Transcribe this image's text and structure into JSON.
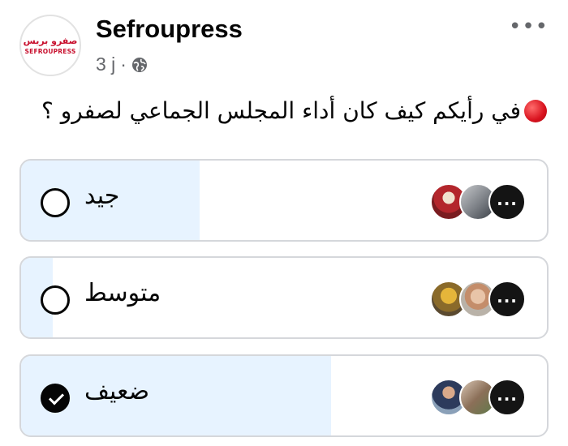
{
  "post": {
    "logo_text_arabic": "صفرو بريس",
    "logo_text_latin": "SEFROUPRESS",
    "page_name": "Sefroupress",
    "time": "3 j",
    "separator": "·",
    "question": "في رأيكم كيف كان أداء المجلس الجماعي لصفرو ؟",
    "more_icon": "more-horizontal-icon",
    "audience_icon": "globe-icon"
  },
  "poll": {
    "options": [
      {
        "label": "جيد",
        "selected": false,
        "vote_fraction": 0.34,
        "more_voters": "..."
      },
      {
        "label": "متوسط",
        "selected": false,
        "vote_fraction": 0.06,
        "more_voters": "..."
      },
      {
        "label": "ضعيف",
        "selected": true,
        "vote_fraction": 0.59,
        "more_voters": "..."
      }
    ]
  },
  "colors": {
    "fill": "#e7f3ff",
    "border": "#d5d7db",
    "accent_red": "#d8121e",
    "text": "#050505",
    "muted": "#65676b"
  }
}
